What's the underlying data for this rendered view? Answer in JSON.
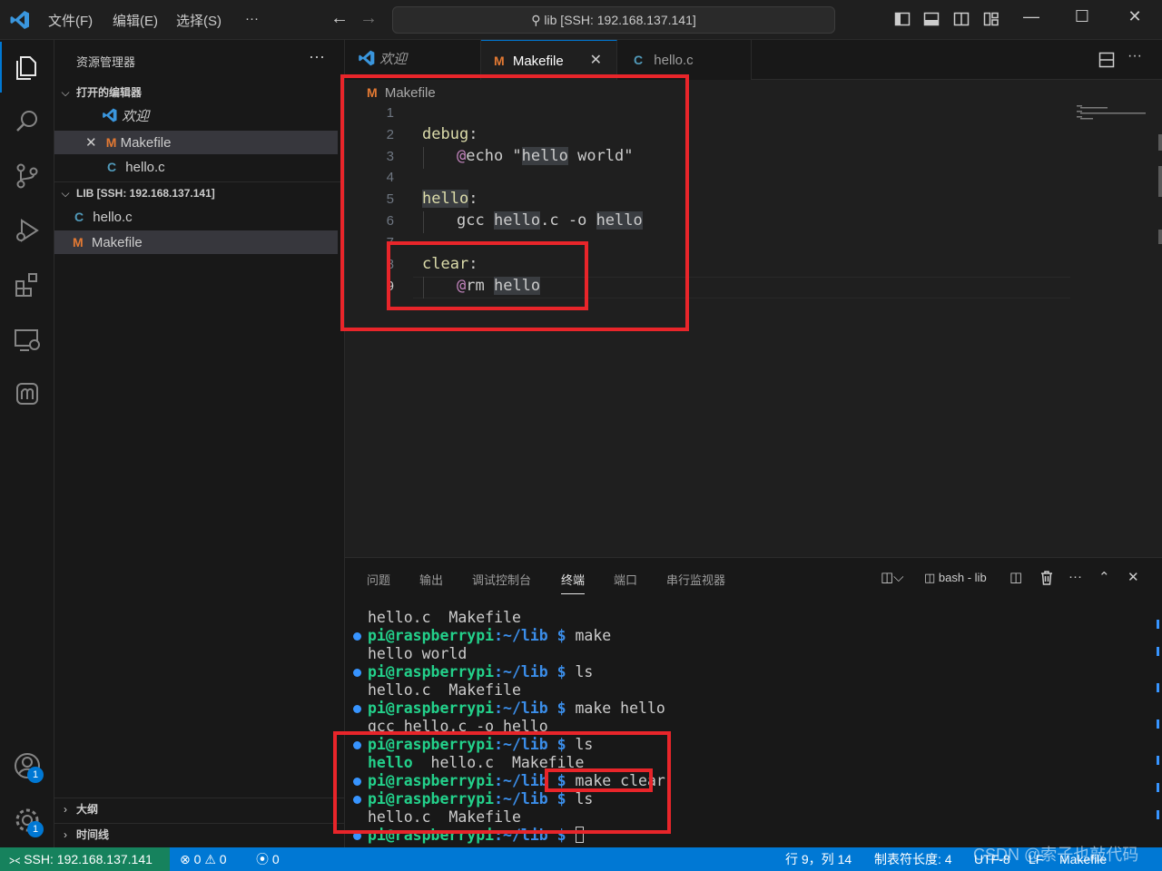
{
  "titlebar": {
    "menus": [
      "文件(F)",
      "编辑(E)",
      "选择(S)",
      "···"
    ],
    "command_center": "lib [SSH: 192.168.137.141]"
  },
  "activity": {
    "account_badge": "1",
    "settings_badge": "1"
  },
  "sidebar": {
    "title": "资源管理器",
    "more": "···",
    "open_editors": {
      "header": "打开的编辑器",
      "items": [
        {
          "label": "欢迎",
          "icon": "vscode-icon"
        },
        {
          "label": "Makefile",
          "icon": "makefile-icon",
          "close": "✕"
        },
        {
          "label": "hello.c",
          "icon": "c-file-icon"
        }
      ]
    },
    "folder": {
      "header": "LIB [SSH: 192.168.137.141]",
      "items": [
        {
          "label": "hello.c",
          "icon": "c-file-icon"
        },
        {
          "label": "Makefile",
          "icon": "makefile-icon"
        }
      ]
    },
    "outline": "大纲",
    "timeline": "时间线"
  },
  "tabs": [
    {
      "label": "欢迎",
      "icon": "vscode-icon",
      "active": false
    },
    {
      "label": "Makefile",
      "icon": "makefile-icon",
      "active": true,
      "close": "✕"
    },
    {
      "label": "hello.c",
      "icon": "c-file-icon",
      "active": false
    }
  ],
  "editor": {
    "breadcrumb": "Makefile",
    "line_numbers": [
      "1",
      "2",
      "3",
      "4",
      "5",
      "6",
      "7",
      "8",
      "9"
    ],
    "lines": [
      "",
      "debug:",
      "@echo \"hello world\"",
      "",
      "hello:",
      "gcc hello.c -o hello",
      "",
      "clear:",
      "@rm hello"
    ]
  },
  "panel": {
    "tabs": [
      "问题",
      "输出",
      "调试控制台",
      "终端",
      "端口",
      "串行监视器"
    ],
    "active_tab": "终端",
    "terminal_name": "bash - lib",
    "prompt_user": "pi@raspberrypi",
    "prompt_path": ":~/lib $",
    "terminal": [
      {
        "type": "out",
        "text": "hello.c  Makefile"
      },
      {
        "type": "cmd",
        "text": "make"
      },
      {
        "type": "out",
        "text": "hello world"
      },
      {
        "type": "cmd",
        "text": "ls"
      },
      {
        "type": "out",
        "text": "hello.c  Makefile"
      },
      {
        "type": "cmd",
        "text": "make hello"
      },
      {
        "type": "out",
        "text": "gcc hello.c -o hello"
      },
      {
        "type": "cmd",
        "text": "ls"
      },
      {
        "type": "ls2",
        "exe": "hello",
        "rest": "  hello.c  Makefile"
      },
      {
        "type": "cmd",
        "text": "make clear"
      },
      {
        "type": "cmd",
        "text": "ls"
      },
      {
        "type": "out",
        "text": "hello.c  Makefile"
      },
      {
        "type": "cmdcursor",
        "text": ""
      }
    ]
  },
  "statusbar": {
    "remote": "SSH: 192.168.137.141",
    "errors": "0",
    "warnings": "0",
    "ports": "0",
    "position": "行 9，列 14",
    "tab_size": "制表符长度: 4",
    "encoding": "UTF-8",
    "eol": "LF",
    "language": "Makefile"
  },
  "watermark": "CSDN @索子也敲代码",
  "colors": {
    "accent": "#0078d4",
    "remote_green": "#16825d",
    "annotation_red": "#e8252a"
  }
}
